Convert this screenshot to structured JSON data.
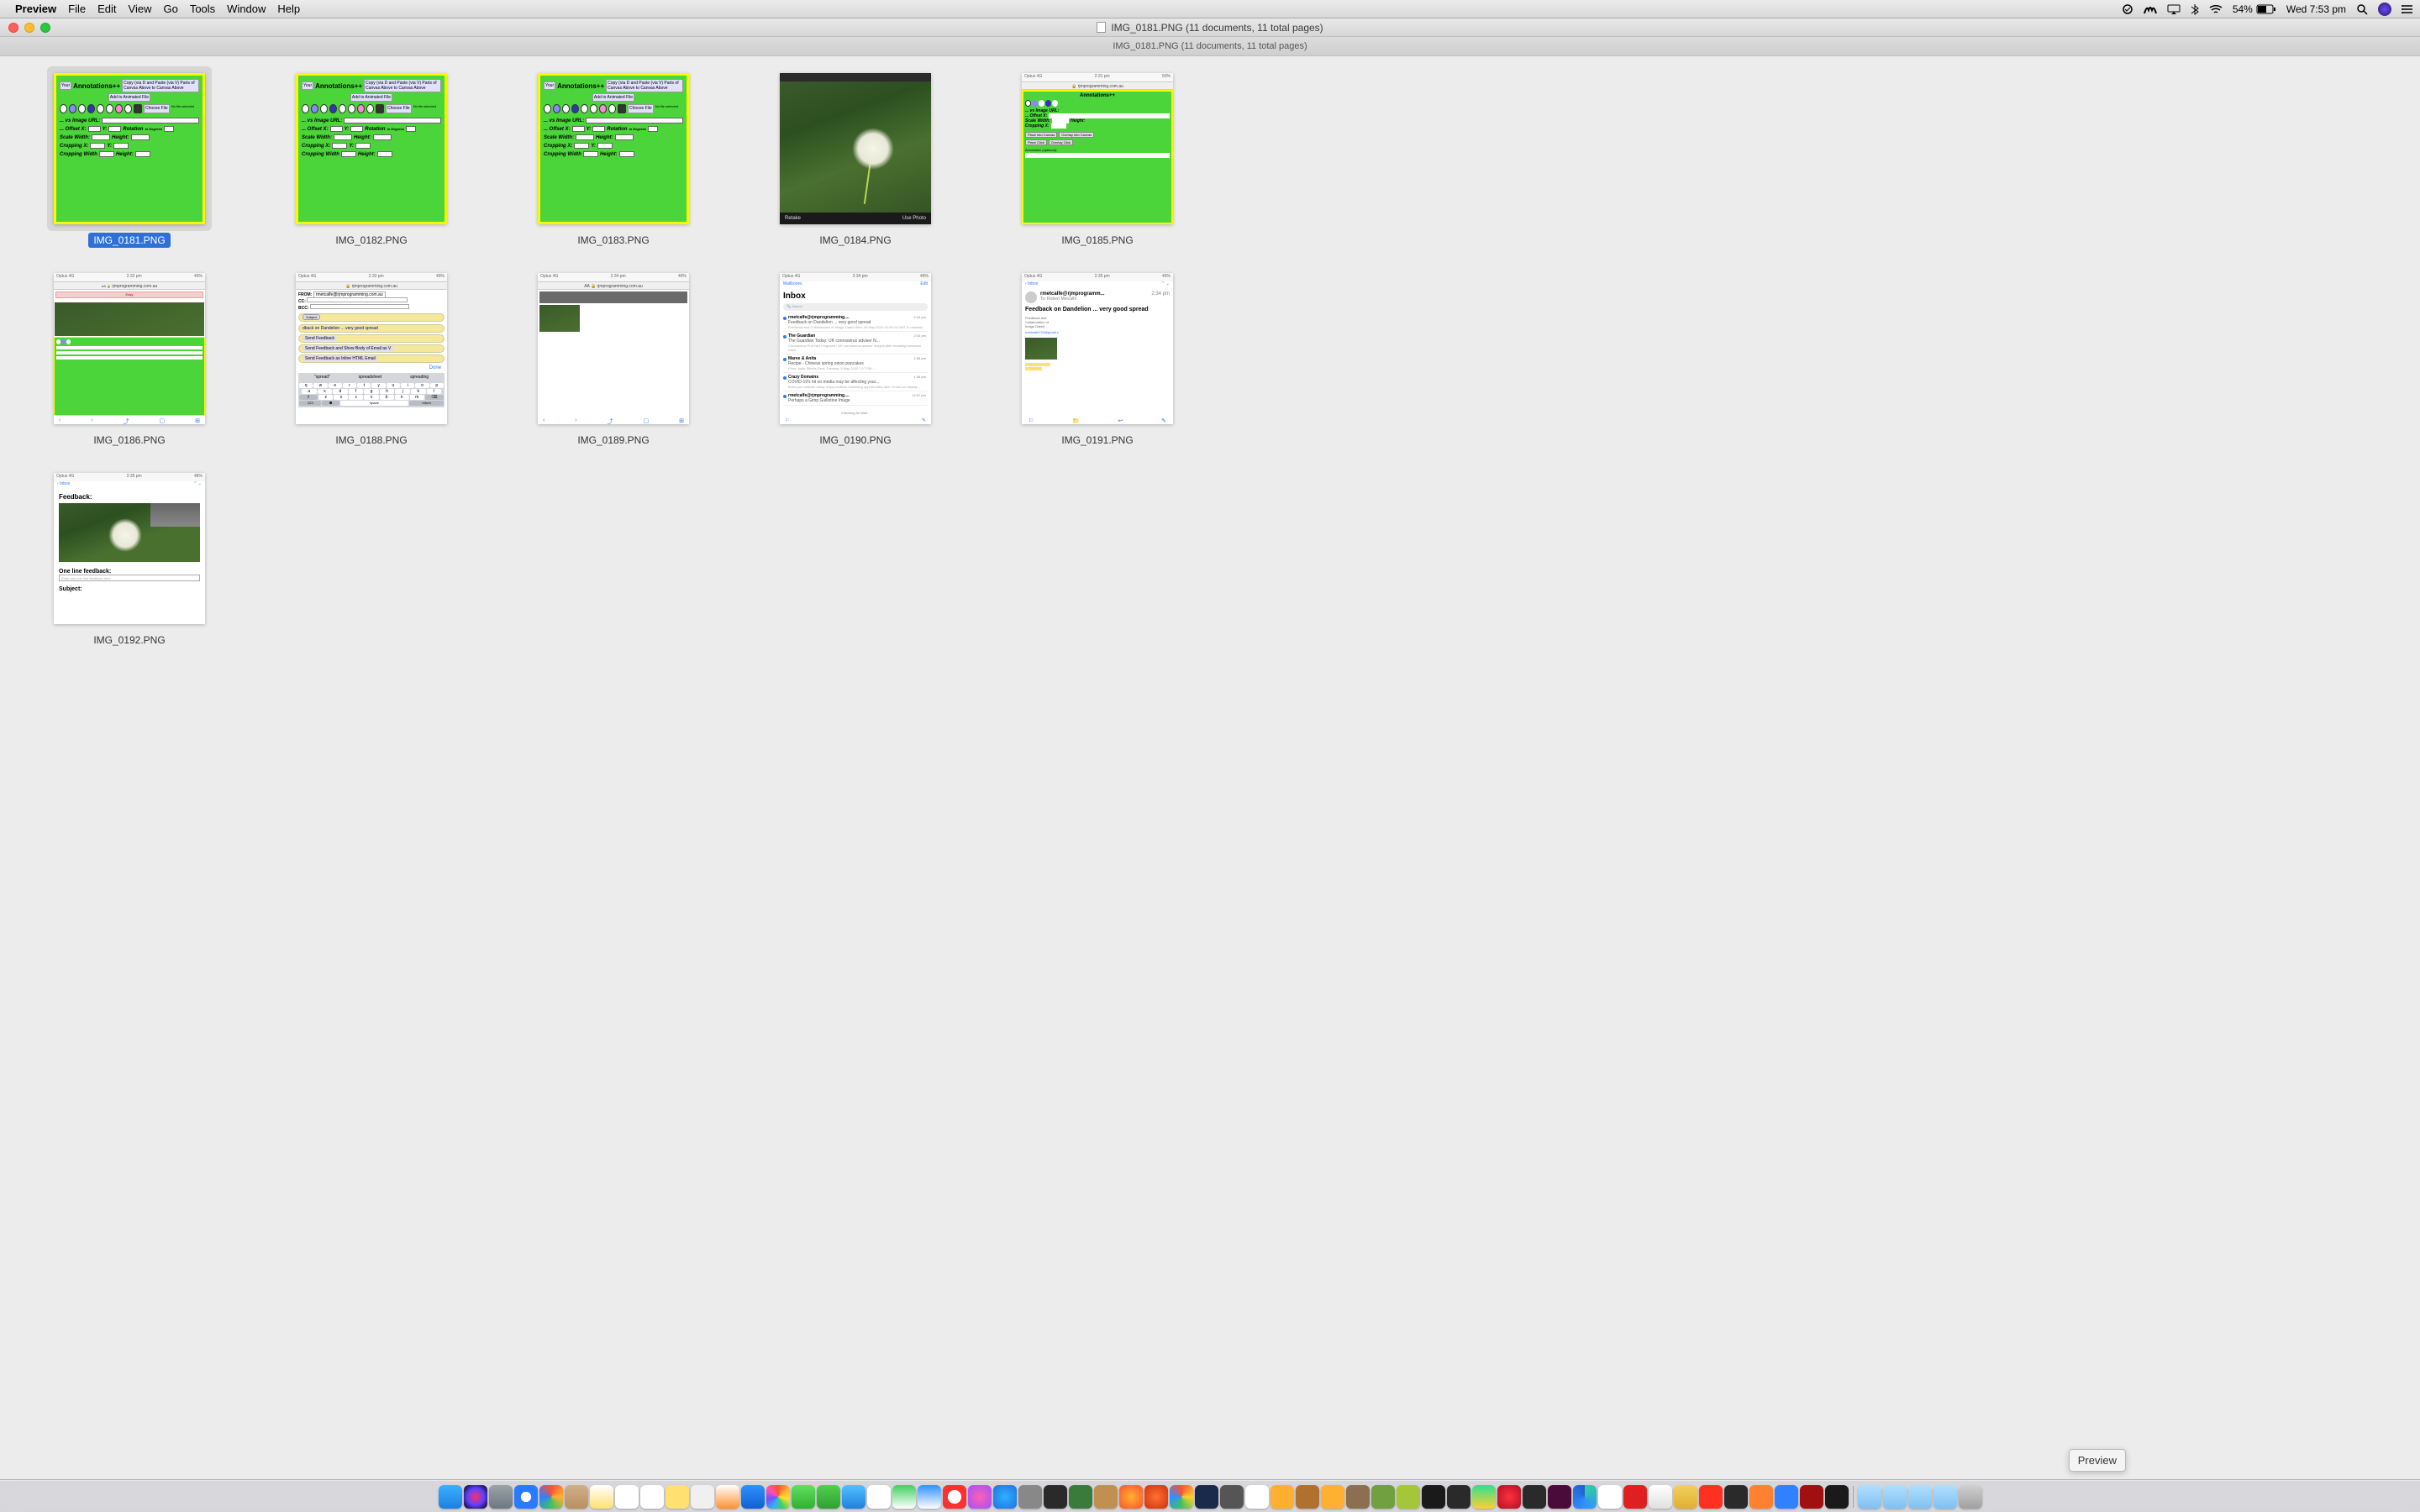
{
  "menubar": {
    "app_name": "Preview",
    "items": [
      "File",
      "Edit",
      "View",
      "Go",
      "Tools",
      "Window",
      "Help"
    ],
    "battery_pct": "54%",
    "clock": "Wed 7:53 pm"
  },
  "window": {
    "title": "IMG_0181.PNG (11 documents, 11 total pages)",
    "tab_title": "IMG_0181.PNG (11 documents, 11 total pages)"
  },
  "thumbnails": [
    {
      "filename": "IMG_0181.PNG",
      "kind": "green",
      "selected": true
    },
    {
      "filename": "IMG_0182.PNG",
      "kind": "green",
      "selected": false
    },
    {
      "filename": "IMG_0183.PNG",
      "kind": "green",
      "selected": false
    },
    {
      "filename": "IMG_0184.PNG",
      "kind": "dandelion",
      "selected": false
    },
    {
      "filename": "IMG_0185.PNG",
      "kind": "green-phone",
      "selected": false
    },
    {
      "filename": "IMG_0186.PNG",
      "kind": "phone-green",
      "selected": false
    },
    {
      "filename": "IMG_0188.PNG",
      "kind": "phone-email",
      "selected": false
    },
    {
      "filename": "IMG_0189.PNG",
      "kind": "phone-attach",
      "selected": false
    },
    {
      "filename": "IMG_0190.PNG",
      "kind": "phone-inbox",
      "selected": false
    },
    {
      "filename": "IMG_0191.PNG",
      "kind": "phone-message",
      "selected": false
    },
    {
      "filename": "IMG_0192.PNG",
      "kind": "phone-feedback",
      "selected": false
    }
  ],
  "green_app": {
    "title": "Annotations++",
    "btn1": "Copy (via D and Paste (via V) Parts of Canvas Above to Canvas Above",
    "btn2": "Add to Animated File",
    "choose": "Choose File",
    "nofile": "No file selected",
    "url_label": "... vs Image URL:",
    "offset_label": "... Offset X:",
    "y_label": "Y:",
    "rotation_label": "Rotation",
    "degrees": "in Degrees",
    "scale_w": "Scale Width:",
    "height_label": "Height:",
    "crop_x": "Cropping X:",
    "crop_w": "Cropping Width",
    "place": "Place into Canvas",
    "overlay": "Overlay into Canvas"
  },
  "dandelion": {
    "retake": "Retake",
    "use": "Use Photo"
  },
  "phone": {
    "carrier": "Optus 4G",
    "time": "2:31 pm",
    "batt": "50%",
    "url": "rjmprogramming.com.au",
    "mailboxes": "Mailboxes",
    "edit": "Edit",
    "inbox_title": "Inbox",
    "search": "Search",
    "back_inbox": "Inbox"
  },
  "inbox": [
    {
      "from": "rmetcalfe@rjmprogramming....",
      "subj": "Feedback on Dandelion ... very good spread",
      "prev": "Feedback and Collaboration of Image Dated Wed, 06 May 2020 04:34:05 GMT to rmetcalf...",
      "time": "2:34 pm"
    },
    {
      "from": "The Guardian",
      "subj": "The Guardian Today: UK coronavirus adviser N...",
      "prev": "Coronavirus Prof Neil Ferguson / UK coronavirus adviser resigns after breaking lockdown rules...",
      "time": "2:04 pm"
    },
    {
      "from": "Maree & Anita",
      "subj": "Recipe - Chinese spring onion pancakes",
      "prev": "From: Anita Siberis <asiberis@bigpond.net.au> Sent: Tuesday, 5 May 2020 7:17 PM...",
      "time": "1:58 pm"
    },
    {
      "from": "Crazy Domains",
      "subj": "COVID-19's hit on media may be affecting your...",
      "prev": "Build your website today. Enjoy endless marketing opportunities later. Email not display...",
      "time": "1:36 pm"
    },
    {
      "from": "rmetcalfe@rjmprogramming....",
      "subj": "Perhaps a Gimp Guillotine Image",
      "prev": "",
      "time": "12:57 pm"
    }
  ],
  "message": {
    "from": "rmetcalfe@rjmprogramm...",
    "to": "To: Robert Metcalfe",
    "time": "2:34 pm",
    "subject": "Feedback on Dandelion ... very good spread",
    "body1": "Feedback and",
    "body2": "Collaboration of",
    "body3": "Image Dated"
  },
  "email_form": {
    "from_lbl": "FROM:",
    "from_val": "rmetcalfe@rjmprogramming.com.au",
    "cc": "CC:",
    "bcc": "BCC:",
    "subject": "Subject",
    "subj_val": "dback on Dandelion ... very good spread",
    "send": "Send Feedback",
    "send_show": "Send Feedback and Show Body of Email as V",
    "send_inline": "Send Feedback as Inline HTML Email",
    "done": "Done",
    "kw1": "\"spread\"",
    "kw2": "spreadsheet",
    "kw3": "spreading"
  },
  "feedback": {
    "title": "Feedback:",
    "oneline": "One line feedback:",
    "placeholder": "Enter any one line feedback here",
    "subject": "Subject:"
  },
  "tooltip": "Preview",
  "dock_icons": [
    {
      "name": "finder",
      "bg": "linear-gradient(#3bb0ff,#1e7fe0)"
    },
    {
      "name": "siri",
      "bg": "radial-gradient(circle,#ff3060,#6040ff,#000)"
    },
    {
      "name": "launchpad",
      "bg": "linear-gradient(#9aa3aa,#6d7780)"
    },
    {
      "name": "safari",
      "bg": "radial-gradient(circle,#fff 30%,#2a7aff 32%)"
    },
    {
      "name": "dashboard",
      "bg": "conic-gradient(#ff5030,#ffb030,#40c060,#3080ff,#ff5030)"
    },
    {
      "name": "contacts",
      "bg": "linear-gradient(#d0b088,#b89060)"
    },
    {
      "name": "notes",
      "bg": "linear-gradient(#fff,#ffe070)"
    },
    {
      "name": "reminders",
      "bg": "#fff"
    },
    {
      "name": "calendar",
      "bg": "#fff"
    },
    {
      "name": "stickies",
      "bg": "#ffe070"
    },
    {
      "name": "textedit",
      "bg": "#f0f0f0"
    },
    {
      "name": "pages",
      "bg": "linear-gradient(#fff,#ff9030)"
    },
    {
      "name": "xcode",
      "bg": "linear-gradient(#3090ff,#1060d0)"
    },
    {
      "name": "photos",
      "bg": "conic-gradient(#ff5030,#ffb030,#ffe030,#40d060,#30b0ff,#7050ff,#ff50b0,#ff5030)"
    },
    {
      "name": "messages",
      "bg": "linear-gradient(#60e060,#30b030)"
    },
    {
      "name": "wechat",
      "bg": "linear-gradient(#50d050,#30a030)"
    },
    {
      "name": "mail",
      "bg": "linear-gradient(#50c0ff,#2080e0)"
    },
    {
      "name": "filezilla",
      "bg": "#fff"
    },
    {
      "name": "numbers",
      "bg": "linear-gradient(#40d060,#fff)"
    },
    {
      "name": "keynote",
      "bg": "linear-gradient(#3090ff,#fff)"
    },
    {
      "name": "prohibit",
      "bg": "radial-gradient(circle,#fff 40%,#ff3030 42%)"
    },
    {
      "name": "itunes",
      "bg": "radial-gradient(circle,#ff60b0,#a050ff)"
    },
    {
      "name": "appstore",
      "bg": "radial-gradient(circle,#30b0ff,#2070e0)"
    },
    {
      "name": "automator",
      "bg": "#888"
    },
    {
      "name": "terminal",
      "bg": "#2a2a2a"
    },
    {
      "name": "bug",
      "bg": "#3a7a3a"
    },
    {
      "name": "box",
      "bg": "#c09050"
    },
    {
      "name": "firefox",
      "bg": "radial-gradient(circle,#ffb030,#ff5030)"
    },
    {
      "name": "firefox2",
      "bg": "radial-gradient(circle,#ff7030,#d03010)"
    },
    {
      "name": "chrome",
      "bg": "conic-gradient(#ff5030,#ffd030,#40c060,#3090ff,#ff5030)"
    },
    {
      "name": "photoshop",
      "bg": "#1a2a4a"
    },
    {
      "name": "settings",
      "bg": "#555"
    },
    {
      "name": "panda",
      "bg": "#fff"
    },
    {
      "name": "m",
      "bg": "#ffb030"
    },
    {
      "name": "word",
      "bg": "#b07030"
    },
    {
      "name": "audacity",
      "bg": "#ffb030"
    },
    {
      "name": "gimp",
      "bg": "#8a7050"
    },
    {
      "name": "gimp2",
      "bg": "#70a040"
    },
    {
      "name": "android",
      "bg": "#a4c639"
    },
    {
      "name": "terminal2",
      "bg": "#1a1a1a"
    },
    {
      "name": "noir",
      "bg": "#2a2a2a"
    },
    {
      "name": "pycharm",
      "bg": "linear-gradient(#30e090,#ffd030)"
    },
    {
      "name": "opera",
      "bg": "radial-gradient(circle,#ff3040,#b01020)"
    },
    {
      "name": "obs",
      "bg": "#2a2a2a"
    },
    {
      "name": "xd",
      "bg": "#4a0a3a"
    },
    {
      "name": "edge",
      "bg": "conic-gradient(#30d0a0,#3090ff,#2060d0)"
    },
    {
      "name": "slack",
      "bg": "#fff"
    },
    {
      "name": "flipboard",
      "bg": "#e02020"
    },
    {
      "name": "preview",
      "bg": "linear-gradient(#fff,#e0e0e0)"
    },
    {
      "name": "finder2",
      "bg": "linear-gradient(#f0d060,#e0b030)"
    },
    {
      "name": "filezilla2",
      "bg": "#ff3020"
    },
    {
      "name": "f",
      "bg": "#2a2a2a"
    },
    {
      "name": "books",
      "bg": "#ff8030"
    },
    {
      "name": "zoom",
      "bg": "#3080ff"
    },
    {
      "name": "flash",
      "bg": "#a01010"
    },
    {
      "name": "warn",
      "bg": "#1a1a1a"
    },
    {
      "name": "folder1",
      "bg": "linear-gradient(#b0e0ff,#80c0f0)"
    },
    {
      "name": "folder2",
      "bg": "linear-gradient(#b0e0ff,#80c0f0)"
    },
    {
      "name": "folder3",
      "bg": "linear-gradient(#b0e0ff,#80c0f0)"
    },
    {
      "name": "folder4",
      "bg": "linear-gradient(#b0e0ff,#80c0f0)"
    },
    {
      "name": "trash",
      "bg": "linear-gradient(#d0d0d0,#a0a0a0)"
    }
  ]
}
